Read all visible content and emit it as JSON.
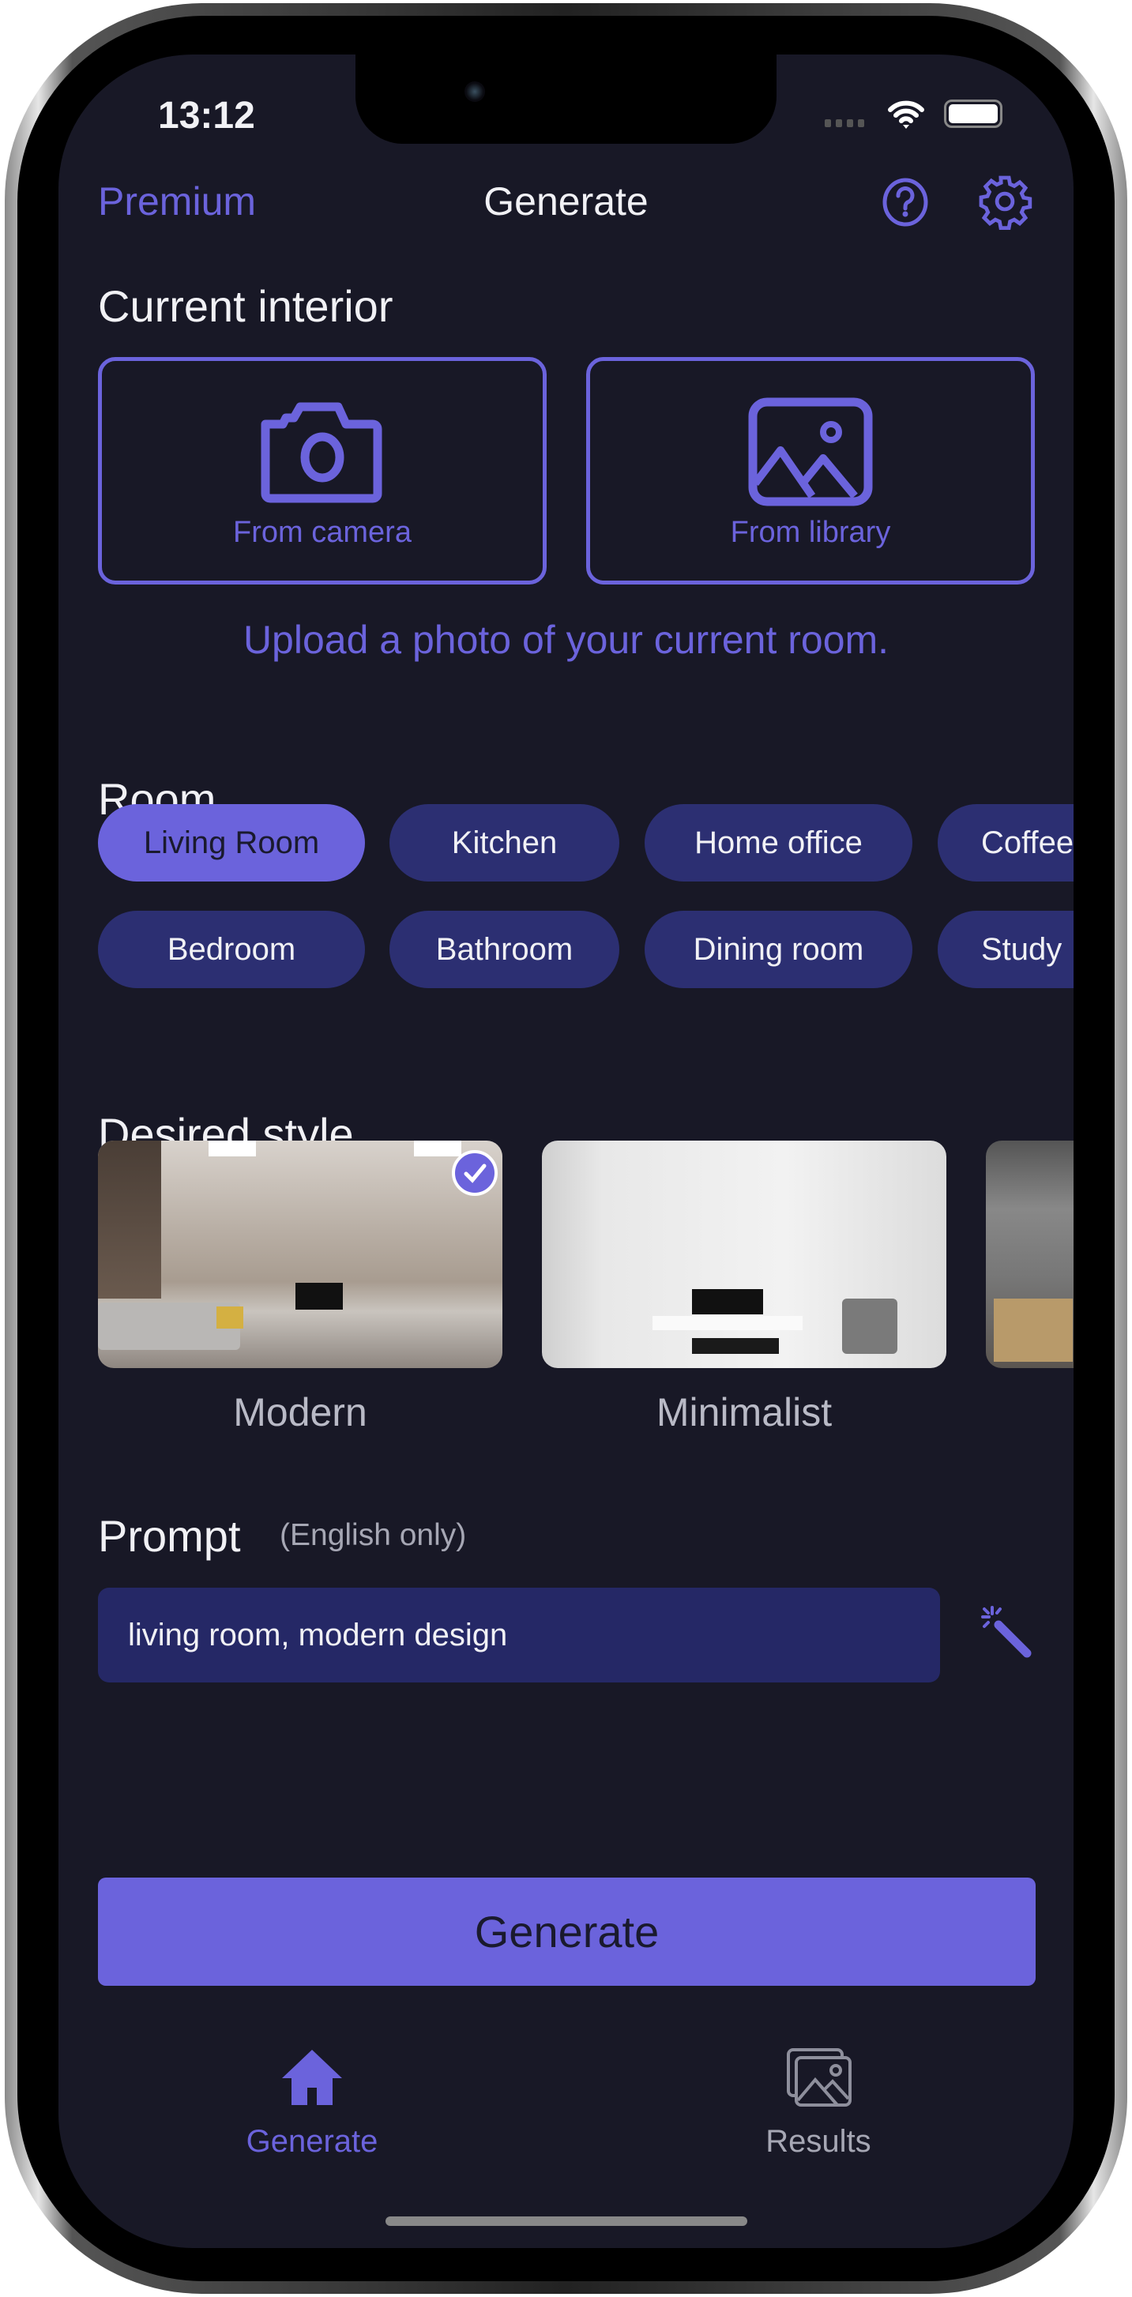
{
  "status_bar": {
    "time": "13:12"
  },
  "header": {
    "premium": "Premium",
    "title": "Generate",
    "help_icon": "question-circle-icon",
    "settings_icon": "gear-icon"
  },
  "current_interior": {
    "heading": "Current interior",
    "camera_label": "From camera",
    "library_label": "From library",
    "hint": "Upload a photo of your current room."
  },
  "room": {
    "heading": "Room",
    "chips": [
      "Living Room",
      "Kitchen",
      "Home office",
      "Coffee",
      "Bedroom",
      "Bathroom",
      "Dining room",
      "Study"
    ],
    "selected": "Living Room"
  },
  "style": {
    "heading": "Desired style",
    "items": [
      "Modern",
      "Minimalist"
    ],
    "selected": "Modern"
  },
  "prompt": {
    "heading": "Prompt",
    "note": "(English only)",
    "value": "living room, modern design"
  },
  "generate_button": "Generate",
  "tabbar": {
    "tabs": [
      "Generate",
      "Results"
    ],
    "active": "Generate"
  },
  "colors": {
    "accent": "#6b63dc",
    "background": "#181826",
    "chip": "#2c2f72",
    "input": "#252866"
  }
}
